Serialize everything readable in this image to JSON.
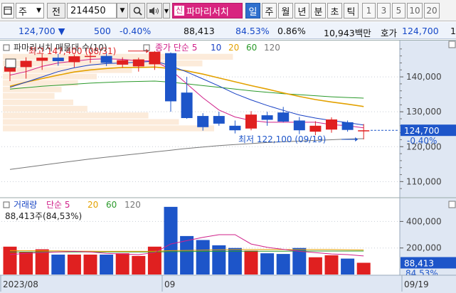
{
  "toolbar": {
    "market": "주",
    "code_label": "전",
    "code": "214450",
    "pamari_label": "파마리서치",
    "period_tabs": [
      {
        "label": "일",
        "selected": true
      },
      {
        "label": "주",
        "selected": false
      },
      {
        "label": "월",
        "selected": false
      },
      {
        "label": "년",
        "selected": false
      },
      {
        "label": "분",
        "selected": false
      },
      {
        "label": "초",
        "selected": false
      },
      {
        "label": "틱",
        "selected": false
      }
    ],
    "numbers": [
      "1",
      "3",
      "5",
      "10",
      "20"
    ]
  },
  "quote": {
    "price": "124,700",
    "change": "500",
    "change_pct": "-0.40%",
    "volume": "88,413",
    "vol_ratio": "84.53%",
    "turnover": "0.86%",
    "amount": "10,943백만",
    "bid_label": "호가",
    "bid_price": "124,700",
    "cut": "1"
  },
  "chart_data": [
    {
      "type": "candlestick",
      "title": "파마리서치 매물대 수(10)",
      "legend": [
        {
          "label": "종가 단순 5",
          "color": "#d0218a"
        },
        {
          "label": "10",
          "color": "#1740c4"
        },
        {
          "label": "20",
          "color": "#e3a100"
        },
        {
          "label": "60",
          "color": "#2b9a2b"
        },
        {
          "label": "120",
          "color": "#777777"
        }
      ],
      "high_annotation": "최고 147,400 (08/31)",
      "low_annotation": "최저 122,100 (09/19)",
      "price_axis": [
        "140,000",
        "130,000",
        "120,000",
        "110,000"
      ],
      "ylim": [
        106000,
        150000
      ],
      "current_price": "124,700",
      "current_change": "-0.40%",
      "candles": [
        {
          "o": 141500,
          "h": 144400,
          "l": 138800,
          "c": 143000
        },
        {
          "o": 142800,
          "h": 145600,
          "l": 139500,
          "c": 144600
        },
        {
          "o": 144600,
          "h": 146600,
          "l": 142000,
          "c": 145500
        },
        {
          "o": 145500,
          "h": 146600,
          "l": 143200,
          "c": 144500
        },
        {
          "o": 144200,
          "h": 146400,
          "l": 142700,
          "c": 145900
        },
        {
          "o": 145800,
          "h": 147200,
          "l": 144000,
          "c": 146000
        },
        {
          "o": 146000,
          "h": 146800,
          "l": 143100,
          "c": 144000
        },
        {
          "o": 143500,
          "h": 145600,
          "l": 142600,
          "c": 144800
        },
        {
          "o": 143000,
          "h": 145500,
          "l": 141500,
          "c": 145000
        },
        {
          "o": 143600,
          "h": 147400,
          "l": 142000,
          "c": 147200
        },
        {
          "o": 146800,
          "h": 147000,
          "l": 130000,
          "c": 133000
        },
        {
          "o": 135500,
          "h": 140000,
          "l": 128000,
          "c": 128200
        },
        {
          "o": 128800,
          "h": 129600,
          "l": 124600,
          "c": 125600
        },
        {
          "o": 128800,
          "h": 130000,
          "l": 126000,
          "c": 126600
        },
        {
          "o": 126000,
          "h": 127500,
          "l": 123800,
          "c": 124700
        },
        {
          "o": 125200,
          "h": 130200,
          "l": 124700,
          "c": 129200
        },
        {
          "o": 129000,
          "h": 130000,
          "l": 126000,
          "c": 127700
        },
        {
          "o": 129800,
          "h": 131400,
          "l": 127000,
          "c": 127200
        },
        {
          "o": 127500,
          "h": 128500,
          "l": 123600,
          "c": 124700
        },
        {
          "o": 124300,
          "h": 127300,
          "l": 123300,
          "c": 126000
        },
        {
          "o": 124900,
          "h": 128400,
          "l": 124000,
          "c": 127800
        },
        {
          "o": 127000,
          "h": 127500,
          "l": 124300,
          "c": 124800
        },
        {
          "o": 124500,
          "h": 126500,
          "l": 122100,
          "c": 124700
        }
      ],
      "ma5": [
        140500,
        141500,
        143000,
        144000,
        144500,
        145000,
        145200,
        145000,
        144600,
        144600,
        142000,
        138000,
        134000,
        130500,
        128500,
        127500,
        127000,
        127000,
        127000,
        127000,
        126300,
        126000,
        125400
      ],
      "ma10": [
        137000,
        138500,
        140000,
        141500,
        142600,
        143400,
        143800,
        144000,
        144200,
        144500,
        143200,
        141400,
        139400,
        137400,
        135200,
        133400,
        131800,
        130400,
        129100,
        128200,
        127500,
        126900,
        126200
      ],
      "ma20": [
        137300,
        138500,
        139500,
        140500,
        141400,
        142000,
        142400,
        142700,
        142700,
        142800,
        142400,
        141700,
        140800,
        139700,
        138600,
        137500,
        136500,
        135400,
        134400,
        133500,
        132800,
        132200,
        131500
      ],
      "ma60": [
        136500,
        136900,
        137300,
        137600,
        137900,
        138200,
        138400,
        138600,
        138700,
        138800,
        138500,
        138000,
        137500,
        137000,
        136500,
        136000,
        135600,
        135200,
        134900,
        134600,
        134300,
        134100,
        133900
      ],
      "ma120": [
        113500,
        114100,
        114700,
        115300,
        115900,
        116500,
        117000,
        117500,
        118000,
        118500,
        119000,
        119500,
        119900,
        120300,
        120600,
        120900,
        121200,
        121400,
        121600,
        121800,
        122000,
        122200,
        122300
      ],
      "volume_profile": [
        {
          "low": 144800,
          "high": 146700,
          "share": 0.98
        },
        {
          "low": 142900,
          "high": 144800,
          "share": 0.85
        },
        {
          "low": 141000,
          "high": 142900,
          "share": 0.55
        },
        {
          "low": 139200,
          "high": 141000,
          "share": 0.4
        },
        {
          "low": 137300,
          "high": 139200,
          "share": 0.32
        },
        {
          "low": 135500,
          "high": 137300,
          "share": 0.25
        },
        {
          "low": 133600,
          "high": 135500,
          "share": 0.22
        },
        {
          "low": 131800,
          "high": 133600,
          "share": 0.3
        },
        {
          "low": 129900,
          "high": 131800,
          "share": 0.36
        },
        {
          "low": 128000,
          "high": 129900,
          "share": 0.62
        },
        {
          "low": 126200,
          "high": 128000,
          "share": 0.75
        },
        {
          "low": 124300,
          "high": 126200,
          "share": 0.9
        }
      ]
    },
    {
      "type": "bar",
      "title": "거래량 단순 5",
      "legend": [
        {
          "label": "거래량",
          "color": "#1d49c4"
        },
        {
          "label": "단순 5",
          "color": "#d0218a"
        },
        {
          "label": "20",
          "color": "#e3a100"
        },
        {
          "label": "60",
          "color": "#2b9a2b"
        },
        {
          "label": "120",
          "color": "#777777"
        }
      ],
      "info": "88,413주(84,53%)",
      "volume_axis": [
        "400,000",
        "200,000"
      ],
      "ylim": [
        0,
        520000
      ],
      "current_volume": "88,413",
      "current_ratio": "84,53%",
      "volumes": [
        210000,
        170000,
        190000,
        150000,
        150000,
        150000,
        150000,
        160000,
        140000,
        210000,
        510000,
        290000,
        260000,
        220000,
        200000,
        180000,
        160000,
        155000,
        200000,
        130000,
        145000,
        120000,
        88413
      ],
      "vol_ma5": [
        150000,
        160000,
        165000,
        170000,
        175000,
        170000,
        160000,
        155000,
        150000,
        165000,
        230000,
        255000,
        280000,
        300000,
        300000,
        230000,
        205000,
        190000,
        175000,
        165000,
        155000,
        150000,
        140000
      ],
      "vol_ma20": [
        180000,
        180000,
        178000,
        178000,
        176000,
        176000,
        175000,
        175000,
        175000,
        176000,
        180000,
        182000,
        184000,
        186000,
        188000,
        188000,
        188000,
        188000,
        188000,
        188000,
        188000,
        186000,
        185000
      ],
      "vol_ma60": [
        170000,
        170000,
        170000,
        170000,
        170000,
        170000,
        170000,
        170000,
        170000,
        170000,
        172000,
        173000,
        174000,
        175000,
        176000,
        176000,
        176000,
        176000,
        177000,
        177000,
        177000,
        177000,
        177000
      ]
    }
  ],
  "date_axis": [
    "2023/08",
    "09",
    "09/19"
  ]
}
